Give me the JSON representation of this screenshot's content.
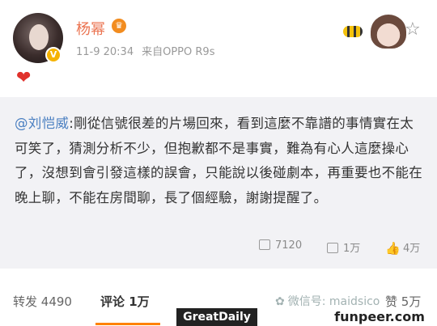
{
  "post": {
    "author": "杨幂",
    "time": "11-9 20:34",
    "source": "来自OPPO R9s",
    "verified_badge": "V",
    "vip_badge": "♛"
  },
  "repost": {
    "mention": "@刘恺威",
    "text": ":剛從信號很差的片場回來，看到這麼不靠譜的事情實在太可笑了，猜測分析不少，但抱歉都不是事實，難為有心人這麼操心了，沒想到會引發這樣的誤會，只能說以後碰劇本，再重要也不能在晚上聊，不能在房間聊，長了個經驗，謝謝提醒了。",
    "repost_count": "7120",
    "comment_count": "1万",
    "like_count": "4万"
  },
  "tabs": {
    "repost_label": "转发",
    "repost_count": "4490",
    "comment_label": "评论",
    "comment_count": "1万",
    "like_label": "赞",
    "like_count": "5万"
  },
  "watermarks": {
    "wechat": "微信号: maidsico",
    "greatdaily": "GreatDaily",
    "funpeer": "funpeer.com"
  },
  "colors": {
    "accent": "#ff8200",
    "author_name": "#eb7350",
    "mention": "#4a7fc1",
    "repost_bg": "#f2f2f5"
  }
}
